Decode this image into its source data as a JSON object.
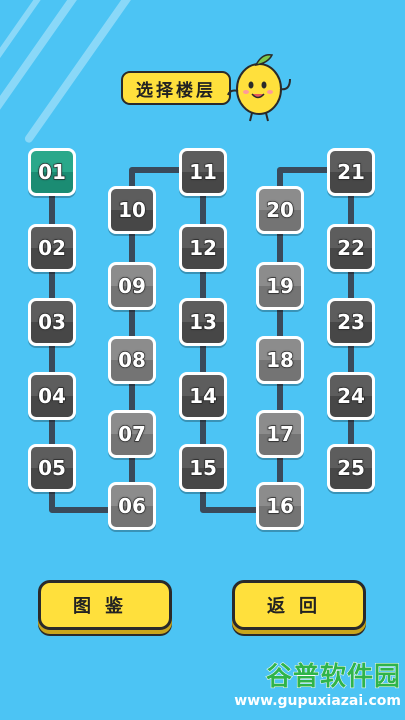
{
  "header": {
    "title": "选择楼层"
  },
  "levels": [
    "01",
    "02",
    "03",
    "04",
    "05",
    "06",
    "07",
    "08",
    "09",
    "10",
    "11",
    "12",
    "13",
    "14",
    "15",
    "16",
    "17",
    "18",
    "19",
    "20",
    "21",
    "22",
    "23",
    "24",
    "25"
  ],
  "current_level": "01",
  "buttons": {
    "gallery": "图鉴",
    "back": "返回"
  },
  "watermark": {
    "name": "谷普软件园",
    "url": "www.gupuxiazai.com"
  },
  "colors": {
    "background": "#4cc4f4",
    "accent": "#ffe03c",
    "active_level": "#1b8c73",
    "path": "#3a4a5a"
  }
}
